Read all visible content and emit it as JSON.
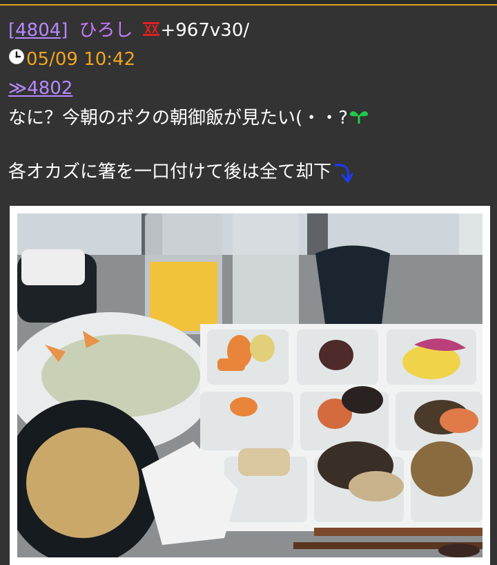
{
  "post": {
    "res_number": "[4804]",
    "name": "ひろし",
    "rank_icon": "roman-ten-icon",
    "score": "+967v30/",
    "date": "05/09 10:42",
    "anchor": "≫4802",
    "message_line1": "なに？今朝のボクの朝御飯が見たい(・・?",
    "message_line2": "各オカズに箸を一口付けて後は全て却下"
  },
  "icons": {
    "clock": "clock-icon",
    "sprout": "sprout-icon",
    "arrow": "curved-arrow-down-icon"
  },
  "colors": {
    "background": "#333333",
    "accent_orange": "#f0a51f",
    "link_purple": "#b888ff",
    "name_purple": "#c77bff",
    "rank_red": "#e02020",
    "sprout_green": "#22c94a",
    "arrow_blue": "#1a3cff"
  }
}
